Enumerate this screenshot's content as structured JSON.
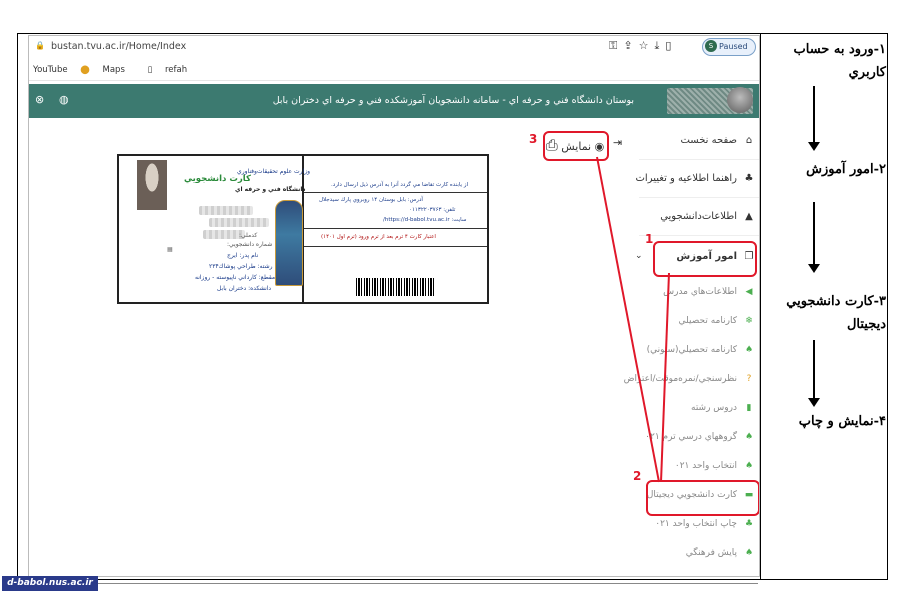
{
  "browser": {
    "url": "bustan.tvu.ac.ir/Home/Index",
    "profile_initial": "S",
    "profile_status": "Paused",
    "bookmarks": [
      "YouTube",
      "Maps",
      "refah"
    ]
  },
  "header": {
    "title": "بوستان دانشگاه فني و حرفه اي - سامانه دانشجويان آموزشكده فني و حرفه اي دختران بابل"
  },
  "sidebar": {
    "items": [
      {
        "label": "صفحه نخست",
        "icon": "home-icon"
      },
      {
        "label": "راهنما اطلاعيه و تغييرات",
        "icon": "sitemap-icon"
      },
      {
        "label": "اطلاعات‌دانشجويي",
        "icon": "graduation-cap-icon"
      },
      {
        "label": "امور آموزش",
        "icon": "copy-icon"
      }
    ],
    "subitems": [
      {
        "label": "اطلاعات‌هاي مدرس",
        "icon": "bullhorn-icon"
      },
      {
        "label": "كارنامه تحصيلي",
        "icon": "snowflake-icon"
      },
      {
        "label": "كارنامه تحصيلي(ستوني)",
        "icon": "bell-icon"
      },
      {
        "label": "نظرسنجي/نمره‌موقت/اعتراض",
        "icon": "question-icon"
      },
      {
        "label": "دروس رشته",
        "icon": "bookmark-icon"
      },
      {
        "label": "گروههاي درسي ترم ۰۲۱",
        "icon": "bell-icon"
      },
      {
        "label": "انتخاب واحد ۰۲۱",
        "icon": "bell-icon"
      },
      {
        "label": "كارت دانشجويي ديجيتال",
        "icon": "card-icon"
      },
      {
        "label": "چاپ انتخاب واحد ۰۲۱",
        "icon": "sitemap-icon"
      },
      {
        "label": "پايش فرهنگي",
        "icon": "bell-icon"
      }
    ]
  },
  "show_button": "نمايش",
  "card": {
    "title": "كارت دانشجويي",
    "ministry": "وزارت علوم تحقيقات‌وفناوري",
    "university": "دانشگاه فني و حرفه اي",
    "notice": "از يابنده كارت تقاضا مي گردد آنرا به آدرس ذيل ارسال دارد.",
    "address": "آدرس:  بابل بوستان ۱۴ روبروي پارك سيدجلال",
    "phone": "تلفن:  ۰۱۱۳۲۲۰۳۷۶۳",
    "site": "سايت:  https://d-babol.tvu.ac.ir/",
    "validity": "اعتبار كارت ۴ ترم بعد از ترم ورود (ترم اول ۱۴۰۱)",
    "field_1": "كدملي:",
    "field_2": "شماره دانشجويي:",
    "field_3": "نام پدر:  ايرج",
    "field_4": "رشته:  طراحي پوشاك۲۳۴",
    "field_5": "مقطع:  كارداني ناپيوسته - روزانه",
    "field_6": "دانشكده:  دختران بابل"
  },
  "annotations": [
    "1",
    "2",
    "3"
  ],
  "steps": [
    "۱-ورود به حساب كاربري",
    "۲-امور آموزش",
    "۳-كارت دانشجويي ديجيتال",
    "۴-نمايش و چاپ"
  ],
  "watermark": "d-babol.nus.ac.ir",
  "colors": {
    "header": "#3c7a70",
    "annotation": "#e0182a",
    "watermark": "#2a3a8a"
  }
}
